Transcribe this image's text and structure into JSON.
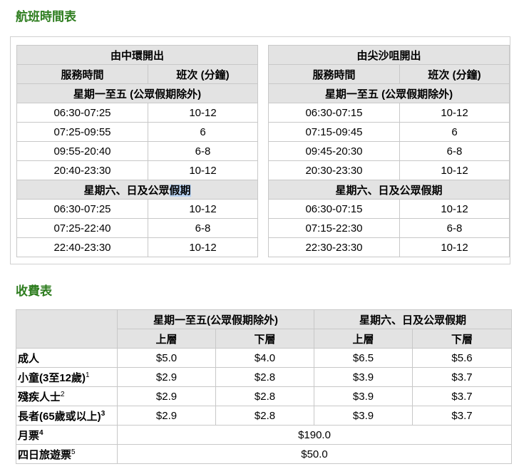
{
  "schedule_title": "航班時間表",
  "fares_title": "收費表",
  "schedules": [
    {
      "title": "由中環開出",
      "col1": "服務時間",
      "col2": "班次 (分鐘)",
      "weekday_label": "星期一至五 (公眾假期除外)",
      "weekday_rows": [
        [
          "06:30-07:25",
          "10-12"
        ],
        [
          "07:25-09:55",
          "6"
        ],
        [
          "09:55-20:40",
          "6-8"
        ],
        [
          "20:40-23:30",
          "10-12"
        ]
      ],
      "weekend_label_prefix": "星期六、日及公眾",
      "weekend_label_highlight": "假期",
      "weekend_rows": [
        [
          "06:30-07:25",
          "10-12"
        ],
        [
          "07:25-22:40",
          "6-8"
        ],
        [
          "22:40-23:30",
          "10-12"
        ]
      ]
    },
    {
      "title": "由尖沙咀開出",
      "col1": "服務時間",
      "col2": "班次 (分鐘)",
      "weekday_label": "星期一至五 (公眾假期除外)",
      "weekday_rows": [
        [
          "06:30-07:15",
          "10-12"
        ],
        [
          "07:15-09:45",
          "6"
        ],
        [
          "09:45-20:30",
          "6-8"
        ],
        [
          "20:30-23:30",
          "10-12"
        ]
      ],
      "weekend_label": "星期六、日及公眾假期",
      "weekend_rows": [
        [
          "06:30-07:15",
          "10-12"
        ],
        [
          "07:15-22:30",
          "6-8"
        ],
        [
          "22:30-23:30",
          "10-12"
        ]
      ]
    }
  ],
  "fares": {
    "group_weekday": "星期一至五(公眾假期除外)",
    "group_weekend": "星期六、日及公眾假期",
    "upper": "上層",
    "lower": "下層",
    "rows": [
      {
        "label": "成人",
        "sup": "",
        "values": [
          "$5.0",
          "$4.0",
          "$6.5",
          "$5.6"
        ]
      },
      {
        "label": "小童(3至12歲)",
        "sup": "1",
        "values": [
          "$2.9",
          "$2.8",
          "$3.9",
          "$3.7"
        ]
      },
      {
        "label": "殘疾人士",
        "sup": "2",
        "values": [
          "$2.9",
          "$2.8",
          "$3.9",
          "$3.7"
        ]
      },
      {
        "label": "長者(65歲或以上)",
        "sup": "3",
        "values": [
          "$2.9",
          "$2.8",
          "$3.9",
          "$3.7"
        ]
      }
    ],
    "monthly": {
      "label": "月票",
      "sup": "4",
      "value": "$190.0"
    },
    "four_day": {
      "label": "四日旅遊票",
      "sup": "5",
      "value": "$50.0"
    }
  }
}
